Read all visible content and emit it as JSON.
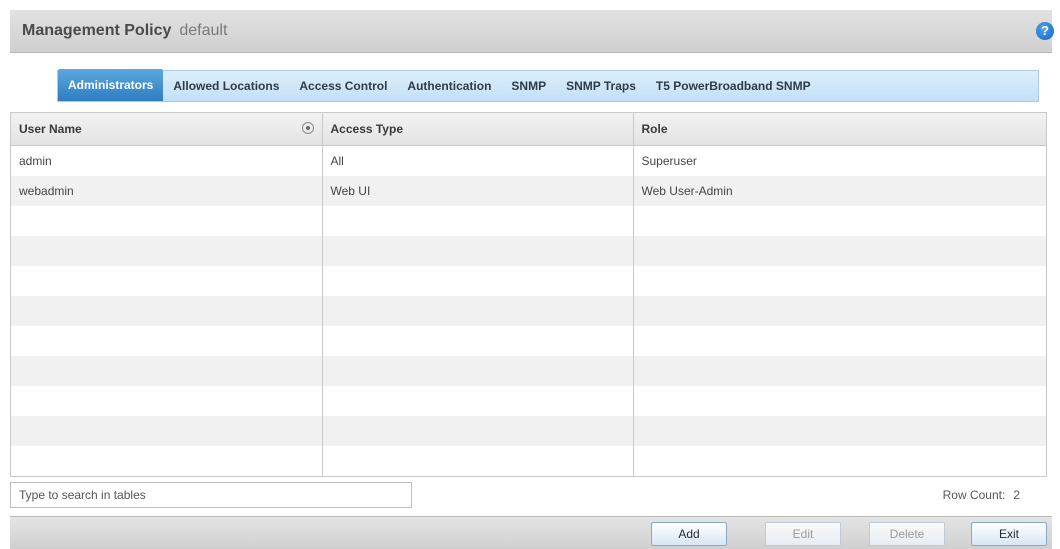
{
  "header": {
    "title": "Management Policy",
    "subtitle": "default",
    "help_icon": "?"
  },
  "tabs": [
    {
      "label": "Administrators",
      "active": true
    },
    {
      "label": "Allowed Locations",
      "active": false
    },
    {
      "label": "Access Control",
      "active": false
    },
    {
      "label": "Authentication",
      "active": false
    },
    {
      "label": "SNMP",
      "active": false
    },
    {
      "label": "SNMP Traps",
      "active": false
    },
    {
      "label": "T5 PowerBroadband SNMP",
      "active": false
    }
  ],
  "table": {
    "columns": [
      "User Name",
      "Access Type",
      "Role"
    ],
    "rows": [
      [
        "admin",
        "All",
        "Superuser"
      ],
      [
        "webadmin",
        "Web UI",
        "Web User-Admin"
      ]
    ]
  },
  "search": {
    "placeholder": "Type to search in tables"
  },
  "row_count": {
    "label": "Row Count:",
    "value": "2"
  },
  "footer": {
    "add_label": "Add",
    "edit_label": "Edit",
    "delete_label": "Delete",
    "exit_label": "Exit"
  },
  "colors": {
    "active_tab": "#2d7dc2",
    "help_icon": "#0f66c8"
  },
  "icons": {
    "help": "help-icon",
    "sort": "sort-icon"
  }
}
